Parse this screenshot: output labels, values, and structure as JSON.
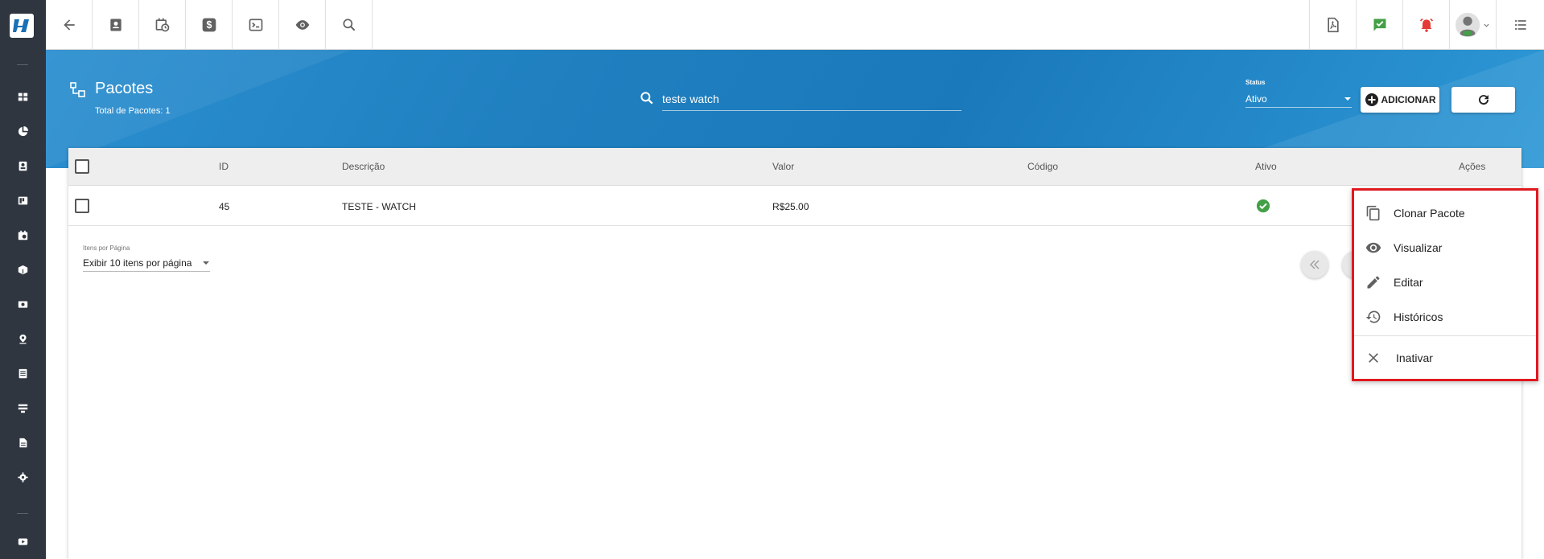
{
  "sidebar": {
    "items": [
      "dashboard-icon",
      "pie-chart-icon",
      "contacts-icon",
      "board-icon",
      "calendar-icon",
      "package-icon",
      "money-icon",
      "location-icon",
      "list-icon",
      "server-icon",
      "document-icon",
      "settings-icon",
      "video-icon"
    ]
  },
  "topbar": {
    "left_icons": [
      "back-arrow-icon",
      "contact-card-icon",
      "calendar-clock-icon",
      "dollar-icon",
      "terminal-icon",
      "eye-icon",
      "search-icon"
    ],
    "right_icons": [
      "pdf-icon",
      "chat-check-icon",
      "alarm-icon",
      "avatar",
      "list-icon"
    ]
  },
  "header": {
    "title": "Pacotes",
    "subtitle": "Total de Pacotes: 1",
    "search_value": "teste watch",
    "status_label": "Status",
    "status_value": "Ativo",
    "add_label": "ADICIONAR"
  },
  "table": {
    "columns": {
      "id": "ID",
      "descricao": "Descrição",
      "valor": "Valor",
      "codigo": "Código",
      "ativo": "Ativo",
      "acoes": "Ações"
    },
    "rows": [
      {
        "id": "45",
        "descricao": "TESTE - WATCH",
        "valor": "R$25.00",
        "codigo": "",
        "ativo": true
      }
    ]
  },
  "pagination": {
    "label": "Itens por Página",
    "value": "Exibir 10 itens por página"
  },
  "context_menu": {
    "items": [
      {
        "label": "Clonar Pacote",
        "icon": "copy-icon"
      },
      {
        "label": "Visualizar",
        "icon": "eye-icon"
      },
      {
        "label": "Editar",
        "icon": "pencil-icon"
      },
      {
        "label": "Históricos",
        "icon": "history-icon"
      },
      {
        "label": "Inativar",
        "icon": "close-icon"
      }
    ]
  },
  "colors": {
    "sidebar": "#2f3640",
    "header": "#1f7fbf",
    "success": "#43a047",
    "highlight": "#e0191f",
    "alarm": "#e53935"
  }
}
